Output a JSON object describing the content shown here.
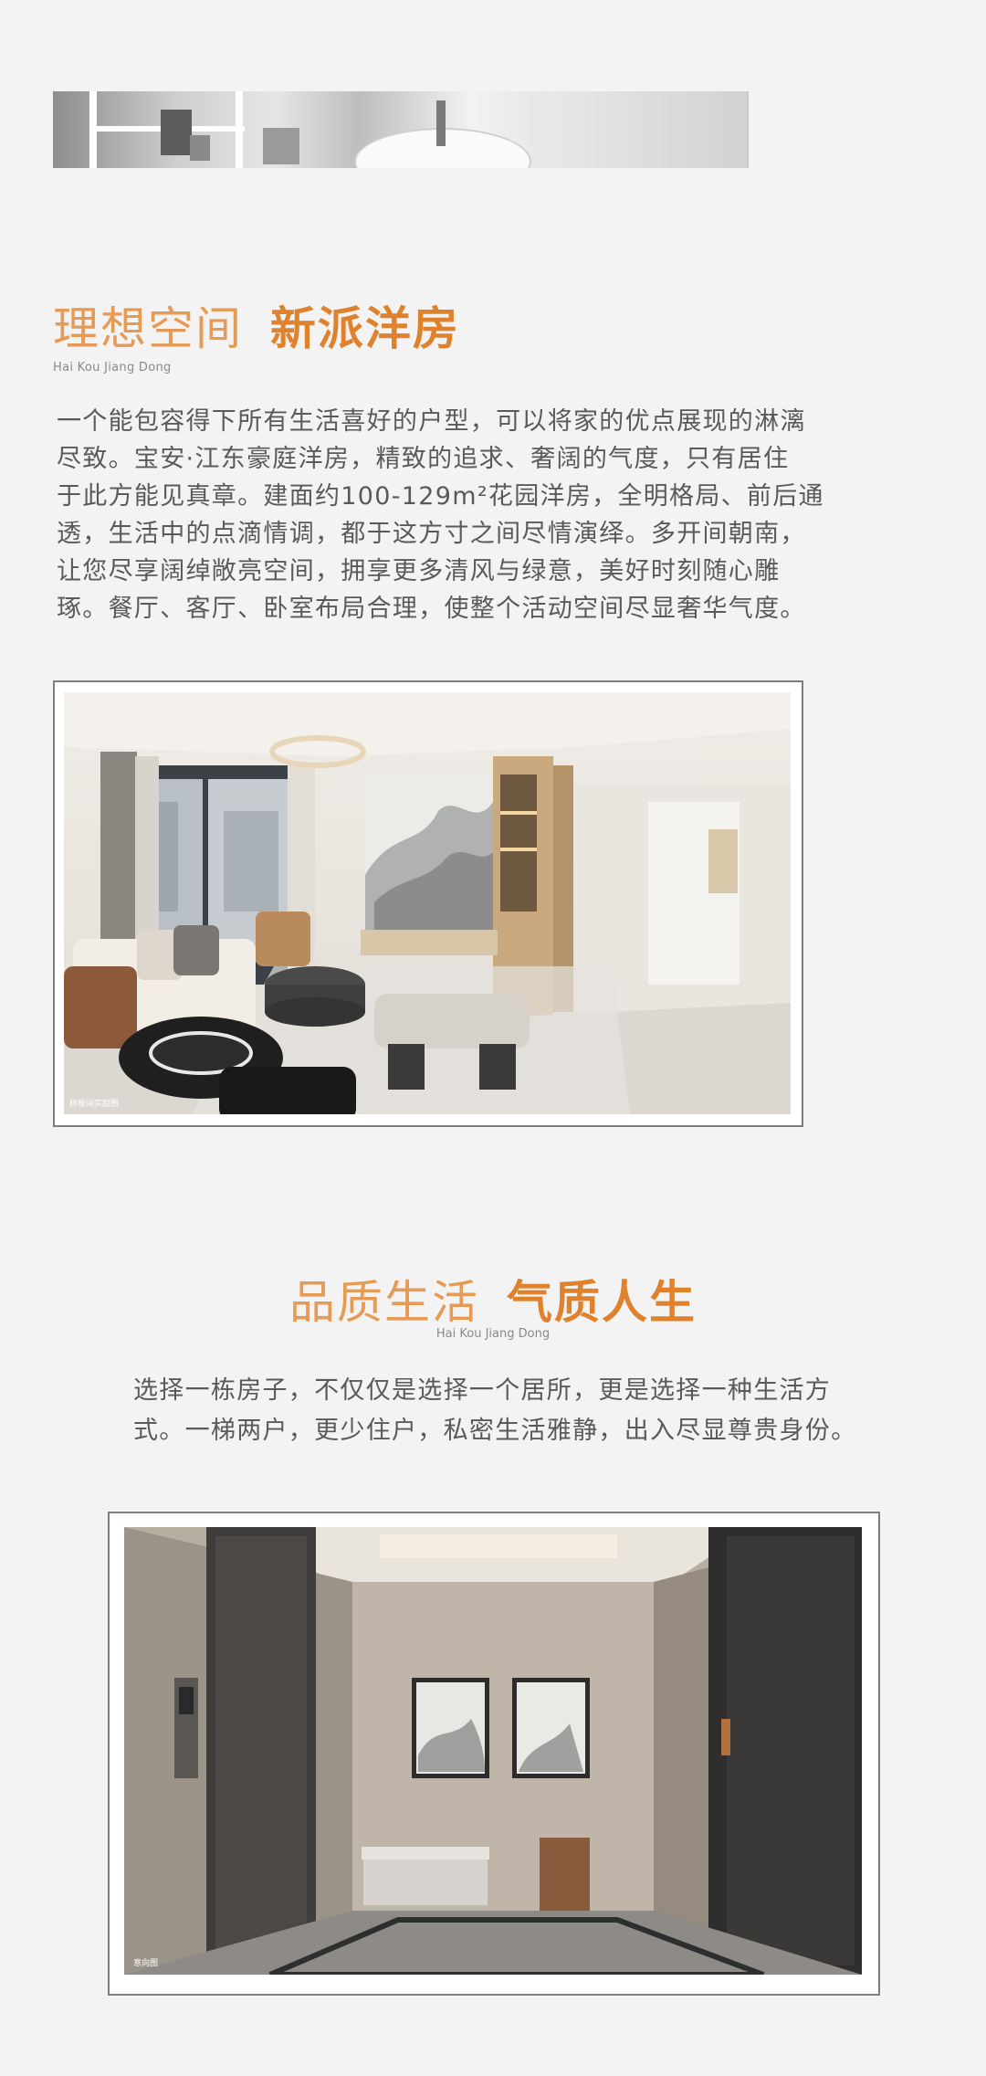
{
  "section1": {
    "title_light": "理想空间",
    "title_bold": "新派洋房",
    "subtitle": "Hai Kou Jiang Dong",
    "paragraph_lines": [
      "一个能包容得下所有生活喜好的户型，可以将家的优点展现的淋漓",
      "尽致。宝安·江东豪庭洋房，精致的追求、奢阔的气度，只有居住",
      "于此方能见真章。建面约100-129m²花园洋房，全明格局、前后通",
      "透，生活中的点滴情调，都于这方寸之间尽情演绎。多开间朝南，",
      "让您尽享阔绰敞亮空间，拥享更多清风与绿意，美好时刻随心雕",
      "琢。餐厅、客厅、卧室布局合理，使整个活动空间尽显奢华气度。"
    ],
    "photo_caption": "样板间实拍图"
  },
  "section2": {
    "title_light": "品质生活",
    "title_bold": "气质人生",
    "subtitle": "Hai Kou Jiang Dong",
    "paragraph_lines": [
      "选择一栋房子，不仅仅是选择一个居所，更是选择一种生活方",
      "式。一梯两户，更少住户，私密生活雅静，出入尽显尊贵身份。"
    ],
    "photo_caption": "意向图"
  },
  "colors": {
    "background": "#f3f3f3",
    "accent_light": "#e59a55",
    "accent_bold": "#e0822c",
    "body_text": "#5a5a5a"
  }
}
